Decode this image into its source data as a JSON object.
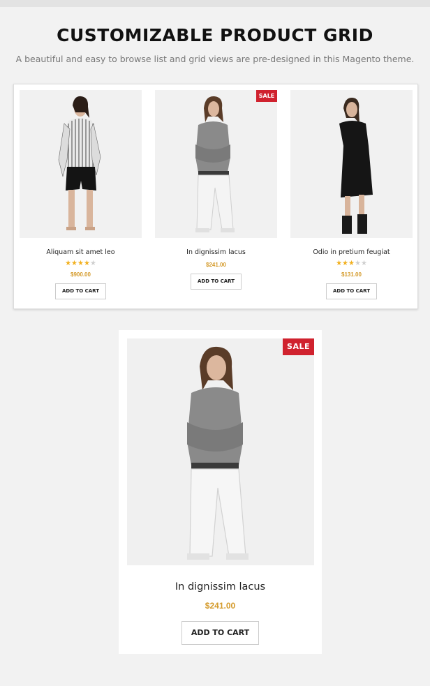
{
  "header": {
    "title": "CUSTOMIZABLE PRODUCT GRID",
    "subtitle": "A beautiful and easy to browse list and grid views are pre-designed in this Magento theme."
  },
  "products": [
    {
      "name": "Aliquam sit amet leo",
      "price": "$900.00",
      "rating": 4,
      "rating_max": 5,
      "sale": false,
      "cart_label": "ADD TO CART"
    },
    {
      "name": "In dignissim lacus",
      "price": "$241.00",
      "sale": true,
      "sale_label": "SALE",
      "cart_label": "ADD TO CART"
    },
    {
      "name": "Odio in pretium feugiat",
      "price": "$131.00",
      "rating": 3,
      "rating_max": 5,
      "sale": false,
      "cart_label": "ADD TO CART"
    }
  ],
  "featured": {
    "name": "In dignissim lacus",
    "price": "$241.00",
    "sale_label": "SALE",
    "cart_label": "ADD TO CART"
  },
  "colors": {
    "sale": "#d0222e",
    "price": "#d49a2a",
    "star": "#f2b01e"
  }
}
